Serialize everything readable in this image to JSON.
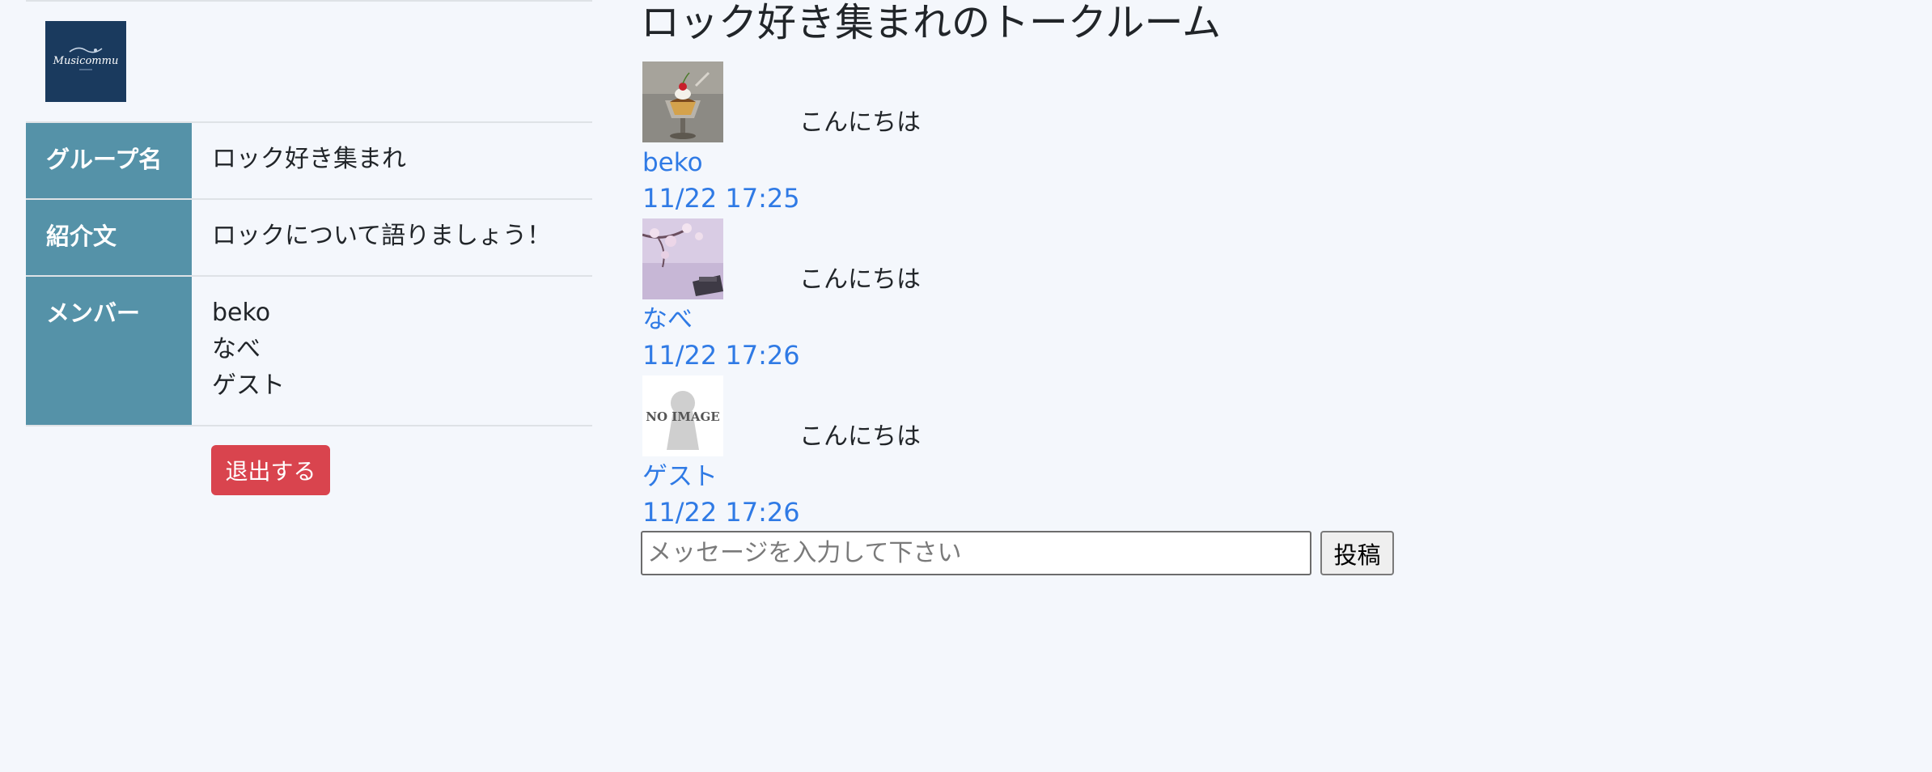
{
  "logo": {
    "text": "Musicommu",
    "icon": "logo-icon",
    "bg_color": "#1a3a5e"
  },
  "group_info": {
    "name_label": "グループ名",
    "name_value": "ロック好き集まれ",
    "intro_label": "紹介文",
    "intro_value": "ロックについて語りましょう！",
    "members_label": "メンバー",
    "members": [
      "beko",
      "なべ",
      "ゲスト"
    ],
    "header_color": "#5592a8"
  },
  "leave_button": {
    "label": "退出する",
    "color": "#d9444e"
  },
  "room": {
    "title": "ロック好き集まれのトークルーム",
    "messages": [
      {
        "avatar": "pudding-photo",
        "text": "こんにちは",
        "user": "beko",
        "time": "11/22 17:25"
      },
      {
        "avatar": "cherry-blossom-photo",
        "text": "こんにちは",
        "user": "なべ",
        "time": "11/22 17:26"
      },
      {
        "avatar": "no-image-placeholder",
        "avatar_text": "NO IMAGE",
        "text": "こんにちは",
        "user": "ゲスト",
        "time": "11/22 17:26"
      }
    ],
    "link_color": "#2f7ae5"
  },
  "composer": {
    "placeholder": "メッセージを入力して下さい",
    "value": "",
    "submit_label": "投稿"
  }
}
